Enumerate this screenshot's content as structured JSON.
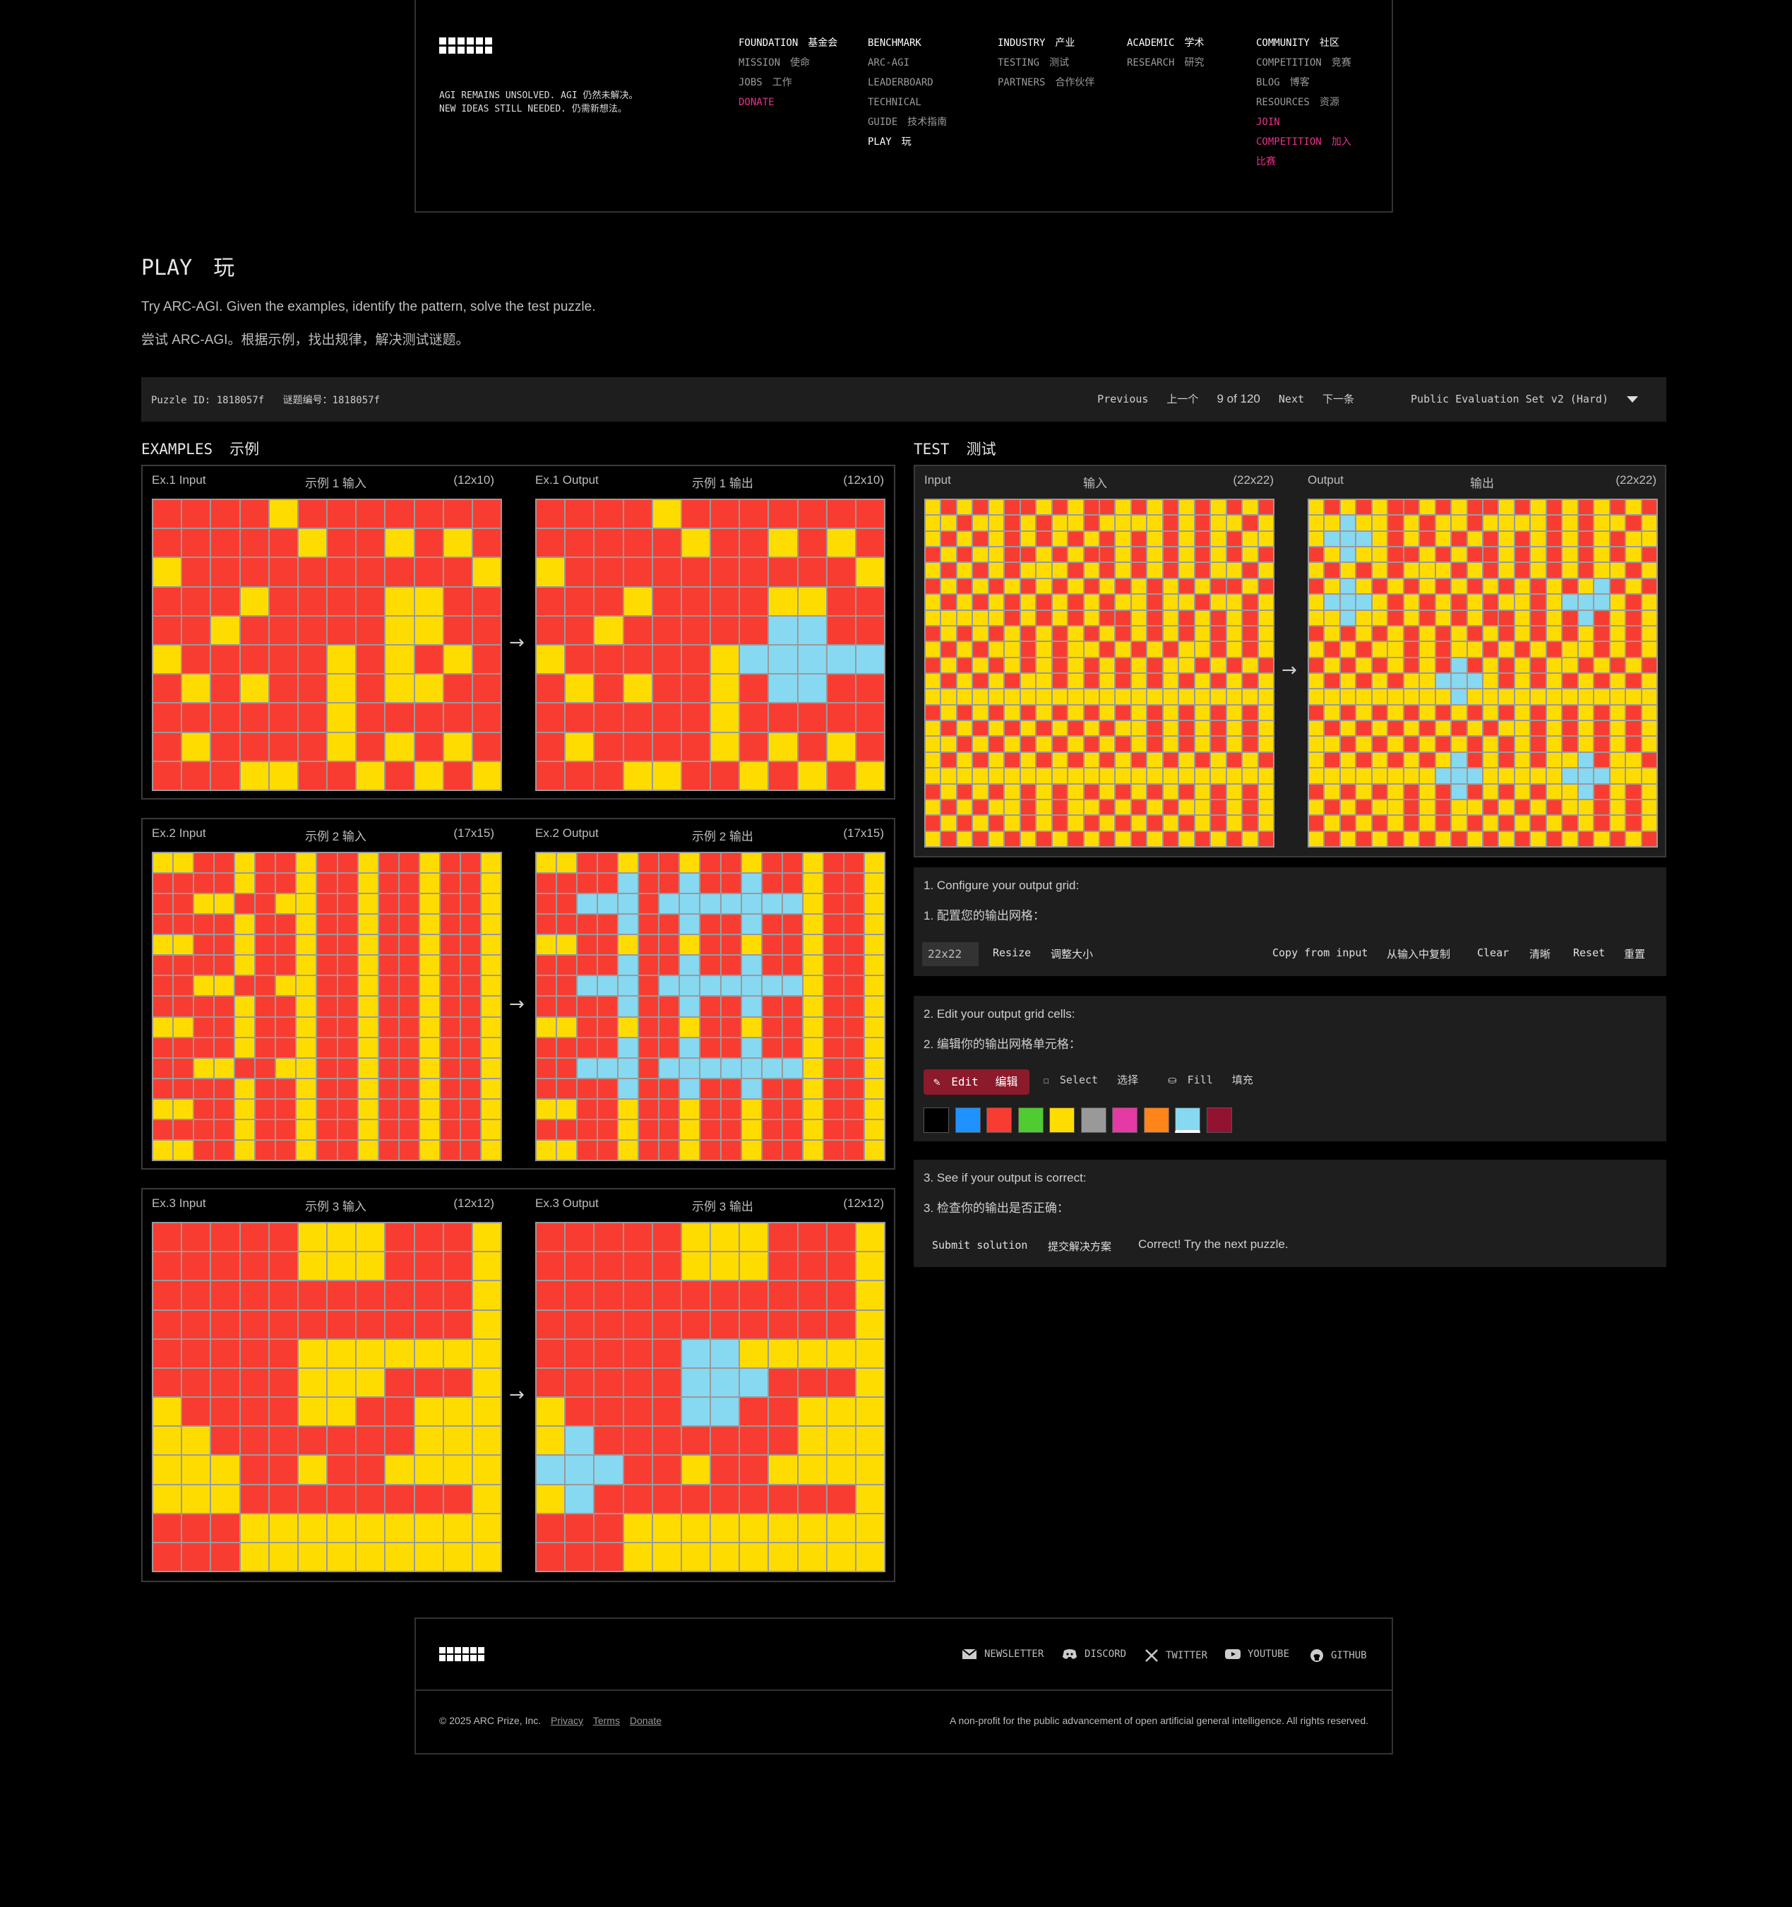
{
  "header": {
    "tagline_line1": "AGI REMAINS UNSOLVED.  AGI 仍然未解决。",
    "tagline_line2": "NEW IDEAS STILL NEEDED.  仍需新想法。",
    "nav": [
      {
        "title": "FOUNDATION",
        "title_cn": "基金会",
        "items": [
          {
            "label": "MISSION",
            "cn": "使命"
          },
          {
            "label": "JOBS",
            "cn": "工作"
          },
          {
            "label": "DONATE",
            "cn": ""
          }
        ]
      },
      {
        "title": "BENCHMARK",
        "title_cn": "",
        "items": [
          {
            "label": "ARC-AGI",
            "cn": ""
          },
          {
            "label": "LEADERBOARD",
            "cn": ""
          },
          {
            "label": "TECHNICAL",
            "cn": ""
          },
          {
            "label": "GUIDE",
            "cn": "技术指南"
          },
          {
            "label": "PLAY",
            "cn": "玩"
          }
        ]
      },
      {
        "title": "INDUSTRY",
        "title_cn": "产业",
        "items": [
          {
            "label": "TESTING",
            "cn": "测试"
          },
          {
            "label": "PARTNERS",
            "cn": "合作伙伴"
          }
        ]
      },
      {
        "title": "ACADEMIC",
        "title_cn": "学术",
        "items": [
          {
            "label": "RESEARCH",
            "cn": "研究"
          }
        ]
      },
      {
        "title": "COMMUNITY",
        "title_cn": "社区",
        "items": [
          {
            "label": "COMPETITION",
            "cn": "竞赛"
          },
          {
            "label": "BLOG",
            "cn": "博客"
          },
          {
            "label": "RESOURCES",
            "cn": "资源"
          },
          {
            "label": "JOIN",
            "cn": ""
          },
          {
            "label": "COMPETITION",
            "cn": "加入"
          },
          {
            "label": "比赛",
            "cn": ""
          }
        ]
      }
    ]
  },
  "page": {
    "title": "PLAY",
    "title_cn": "玩",
    "desc": "Try ARC-AGI. Given the examples, identify the pattern, solve the test puzzle.",
    "desc_cn": "尝试 ARC-AGI。根据示例，找出规律，解决测试谜题。"
  },
  "puzzle_bar": {
    "id_label": "Puzzle ID: 1818057f",
    "id_label_cn": "谜题编号：1818057f",
    "previous": "Previous",
    "previous_cn": "上一个",
    "counter": "9 of 120",
    "next": "Next",
    "next_cn": "下一条",
    "set_select": "Public Evaluation Set v2 (Hard)"
  },
  "examples_header": {
    "title": "EXAMPLES",
    "title_cn": "示例"
  },
  "test_header": {
    "title": "TEST",
    "title_cn": "测试"
  },
  "palette": {
    "0": "#000000",
    "1": "#1e93ff",
    "2": "#f93c31",
    "3": "#4fcc30",
    "4": "#ffdc00",
    "5": "#999999",
    "6": "#e53aa3",
    "7": "#ff851b",
    "8": "#87d8f1",
    "9": "#921231"
  },
  "examples": [
    {
      "in_label": "Ex.1 Input",
      "in_label_cn": "示例 1 输入",
      "in_size": "(12x10)",
      "out_label": "Ex.1 Output",
      "out_label_cn": "示例 1 输出",
      "out_size": "(12x10)",
      "input": [
        "222242222222",
        "222224224242",
        "422222222224",
        "222422224422",
        "224222224422",
        "422222424242",
        "242422424422",
        "222222422222",
        "242222424242",
        "222442242424"
      ],
      "output": [
        "222242222222",
        "222224224242",
        "422222222224",
        "222422224422",
        "224222228822",
        "422222488888",
        "242422428822",
        "222222422222",
        "242222424242",
        "222442242424"
      ]
    },
    {
      "in_label": "Ex.2 Input",
      "in_label_cn": "示例 2 输入",
      "in_size": "(17x15)",
      "out_label": "Ex.2 Output",
      "out_label_cn": "示例 2 输出",
      "out_size": "(17x15)",
      "input": [
        "44224224224224224",
        "22224224224224224",
        "22442244224224224",
        "22224224224224224",
        "44224224224224224",
        "22224224224224224",
        "22442244224224224",
        "22224224224224224",
        "44224224224224224",
        "22224224224224224",
        "22442244224224224",
        "22224224224224224",
        "44224224224224224",
        "22224224224224224",
        "44224224224224224"
      ],
      "output": [
        "44224224224224224",
        "22228228228224224",
        "22888288888884224",
        "22228228228224224",
        "44224224224224224",
        "22228228228224224",
        "22888288888884224",
        "22228228228224224",
        "44224224224224224",
        "22228228228224224",
        "22888288888884224",
        "22228228228224224",
        "44224224224224224",
        "22224224224224224",
        "44224224224224224"
      ]
    },
    {
      "in_label": "Ex.3 Input",
      "in_label_cn": "示例 3 输入",
      "in_size": "(12x12)",
      "out_label": "Ex.3 Output",
      "out_label_cn": "示例 3 输出",
      "out_size": "(12x12)",
      "input": [
        "222224442224",
        "222224442224",
        "222222222224",
        "222222222224",
        "222224444444",
        "222224442224",
        "422224422444",
        "442222222444",
        "444224224444",
        "444222222224",
        "222444444444",
        "222444444444"
      ],
      "output": [
        "222224442224",
        "222224442224",
        "222222222224",
        "222222222224",
        "222228844444",
        "222228882224",
        "422228822444",
        "482222222444",
        "888224224444",
        "482222222224",
        "222444444444",
        "222444444444"
      ]
    }
  ],
  "test": {
    "in_label": "Input",
    "in_label_cn": "输入",
    "in_size": "(22x22)",
    "out_label": "Output",
    "out_label_cn": "输出",
    "out_size": "(22x22)",
    "input": [
      "4242422424224242424242",
      "4424424244244442424424",
      "4242424242424242424244",
      "2424422424224242424242",
      "4242424442424242424424",
      "2424242424242424242242",
      "4242424242424424424424",
      "4444424242422424242424",
      "2424242424242424242424",
      "4242442424424242442424",
      "2424242424242424424242",
      "4242424424242424242424",
      "4444444444444444444444",
      "2424242424242424242424",
      "4242424242424424242424",
      "4424242424242424242424",
      "4242424242424242424242",
      "4444444444444444444444",
      "2424242424242424242424",
      "4242442424424242442424",
      "2424242424242424242424",
      "4242424242424242424242"
    ],
    "output": [
      "4242422424224242424242",
      "4484424244244442424424",
      "4888424242424242424244",
      "2484422424224242424242",
      "4242424442424242424424",
      "2484242424242424248242",
      "4888424242424424888424",
      "4484424242422424282424",
      "2424242424242424242424",
      "4242442424424242442424",
      "2424242428242424424242",
      "4242424488842424242424",
      "4444444448444444444444",
      "2424242424242424242424",
      "4242424242424424242424",
      "4424242424242424242424",
      "4242424248242424482442",
      "4444444488844444888444",
      "2424242428242424482424",
      "4242442424424242442424",
      "2424242424242424242424",
      "4242424242424242424242"
    ]
  },
  "step1": {
    "text": "1. Configure your output grid:",
    "text_cn": "1. 配置您的输出网格：",
    "size_value": "22x22",
    "resize": "Resize",
    "resize_cn": "调整大小",
    "copy": "Copy from input",
    "copy_cn": "从输入中复制",
    "clear": "Clear",
    "clear_cn": "清晰",
    "reset": "Reset",
    "reset_cn": "重置"
  },
  "step2": {
    "text": "2. Edit your output grid cells:",
    "text_cn": "2. 编辑你的输出网格单元格：",
    "edit": "Edit",
    "edit_cn": "编辑",
    "select": "Select",
    "select_cn": "选择",
    "fill": "Fill",
    "fill_cn": "填充",
    "swatches": [
      "#000000",
      "#1e93ff",
      "#f93c31",
      "#4fcc30",
      "#ffdc00",
      "#999999",
      "#e53aa3",
      "#ff851b",
      "#87d8f1",
      "#921231"
    ]
  },
  "step3": {
    "text": "3. See if your output is correct:",
    "text_cn": "3. 检查你的输出是否正确：",
    "submit": "Submit solution",
    "submit_cn": "提交解决方案",
    "result": "Correct! Try the next puzzle."
  },
  "footer": {
    "social": [
      "NEWSLETTER",
      "DISCORD",
      "TWITTER",
      "YOUTUBE",
      "GITHUB"
    ],
    "copyright": "© 2025 ARC Prize, Inc.",
    "privacy": "Privacy",
    "terms": "Terms",
    "donate": "Donate",
    "rights": "A non-profit for the public advancement of open artificial general intelligence. All rights reserved."
  }
}
